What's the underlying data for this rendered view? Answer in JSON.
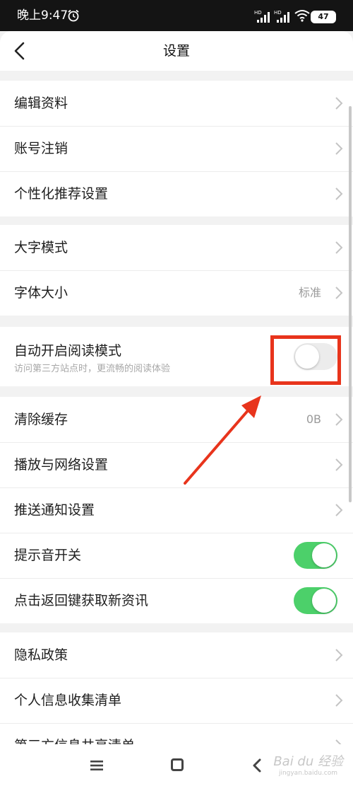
{
  "status_bar": {
    "time": "晚上9:47",
    "alarm_icon": "alarm-clock-icon",
    "signal1_label": "HD",
    "signal2_label": "HD",
    "wifi_icon": "wifi-icon",
    "battery": "47"
  },
  "header": {
    "back_icon": "back-chevron-icon",
    "title": "设置"
  },
  "sections": [
    {
      "rows": [
        {
          "label": "编辑资料"
        },
        {
          "label": "账号注销"
        },
        {
          "label": "个性化推荐设置"
        }
      ]
    },
    {
      "rows": [
        {
          "label": "大字模式"
        },
        {
          "label": "字体大小",
          "value": "标准"
        }
      ]
    },
    {
      "rows": [
        {
          "label": "自动开启阅读模式",
          "subtitle": "访问第三方站点时，更流畅的阅读体验",
          "toggle": false
        }
      ]
    },
    {
      "rows": [
        {
          "label": "清除缓存",
          "value": "0B"
        },
        {
          "label": "播放与网络设置"
        },
        {
          "label": "推送通知设置"
        },
        {
          "label": "提示音开关",
          "toggle": true
        },
        {
          "label": "点击返回键获取新资讯",
          "toggle": true
        }
      ]
    },
    {
      "rows": [
        {
          "label": "隐私政策"
        },
        {
          "label": "个人信息收集清单"
        },
        {
          "label": "第三方信息共享清单"
        }
      ]
    }
  ],
  "navbar": {
    "menu_icon": "menu-icon",
    "home_icon": "home-icon",
    "back_icon": "back-icon",
    "watermark": "Bai du 经验",
    "watermark_sub": "jingyan.baidu.com"
  },
  "colors": {
    "toggle_on": "#4cd06a",
    "toggle_off": "#ececec",
    "annotation": "#e8341c"
  }
}
